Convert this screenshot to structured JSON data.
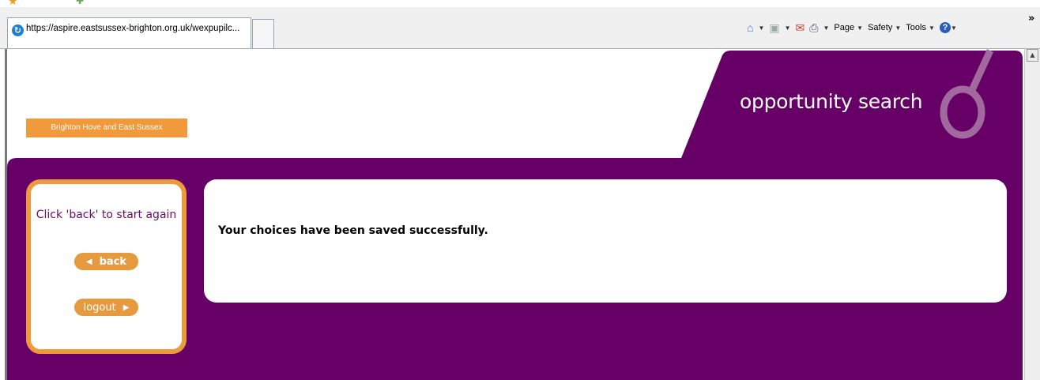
{
  "browser": {
    "tab_title": "https://aspire.eastsussex-brighton.org.uk/wexpupilc...",
    "command_bar": {
      "page_label": "Page",
      "safety_label": "Safety",
      "tools_label": "Tools",
      "more_glyph": "»"
    }
  },
  "header": {
    "brand_label": "Brighton Hove and East Sussex",
    "app_title": "opportunity search"
  },
  "nav": {
    "instruction": "Click 'back' to start again",
    "back_label": "back",
    "logout_label": "logout"
  },
  "content": {
    "message": "Your choices have been saved successfully."
  },
  "colors": {
    "purple": "#660066",
    "orange": "#ed9a3d",
    "white": "#ffffff"
  }
}
